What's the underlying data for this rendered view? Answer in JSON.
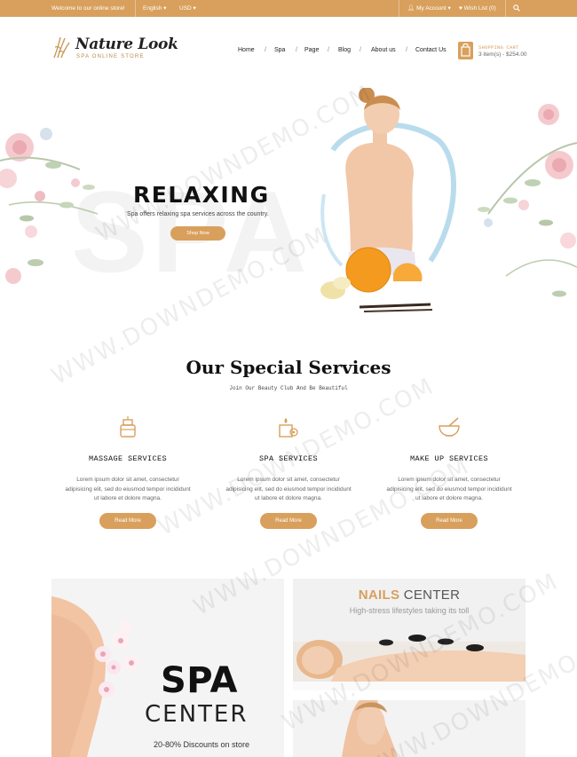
{
  "topbar": {
    "welcome": "Welcome to our online store!",
    "language": "English",
    "currency": "USD",
    "account": "My Account",
    "wishlist": "Wish List (0)"
  },
  "logo": {
    "name": "Nature Look",
    "tagline": "SPA ONLINE STORE"
  },
  "nav": {
    "items": [
      {
        "label": "Home"
      },
      {
        "label": "Spa"
      },
      {
        "label": "Page"
      },
      {
        "label": "Blog"
      },
      {
        "label": "About us"
      },
      {
        "label": "Contact Us"
      }
    ],
    "separator": "/"
  },
  "cart": {
    "title": "SHOPPING CART",
    "summary": "3 item(s) - $254.00"
  },
  "hero": {
    "title": "RELAXING",
    "subtitle": "Spa offers relaxing spa services across the country.",
    "button": "Shop Now",
    "bg_text": "SPA"
  },
  "services": {
    "title": "Our Special Services",
    "subtitle": "Join Our Beauty Club And Be Beautiful",
    "items": [
      {
        "icon": "candle-jar-icon",
        "name": "MASSAGE SERVICES",
        "desc_1": "Lorem ipsum dolor sit amet, consectetur",
        "desc_2": "adipisicing elit, sed do eiusmod tempor incididunt",
        "desc_3": "ut labore et dolore magna.",
        "button": "Read More"
      },
      {
        "icon": "candle-flower-icon",
        "name": "SPA SERVICES",
        "desc_1": "Lorem ipsum dolor sit amet, consectetur",
        "desc_2": "adipisicing elit, sed do eiusmod tempor incididunt",
        "desc_3": "ut labore et dolore magna.",
        "button": "Read More"
      },
      {
        "icon": "mortar-bowl-icon",
        "name": "MAKE UP SERVICES",
        "desc_1": "Lorem ipsum dolor sit amet, consectetur",
        "desc_2": "adipisicing elit, sed do eiusmod tempor incididunt",
        "desc_3": "ut labore et dolore magna.",
        "button": "Read More"
      }
    ]
  },
  "banners": {
    "spa_big": "SPA",
    "spa_center": "CENTER",
    "spa_discount": "20-80% Discounts on store",
    "nails_accent": "NAILS",
    "nails_rest": " CENTER",
    "nails_sub": "High-stress lifestyles taking its toll"
  },
  "watermark": "WWW.DOWNDEMO.COM",
  "colors": {
    "accent": "#d8a05c",
    "text": "#111111"
  }
}
